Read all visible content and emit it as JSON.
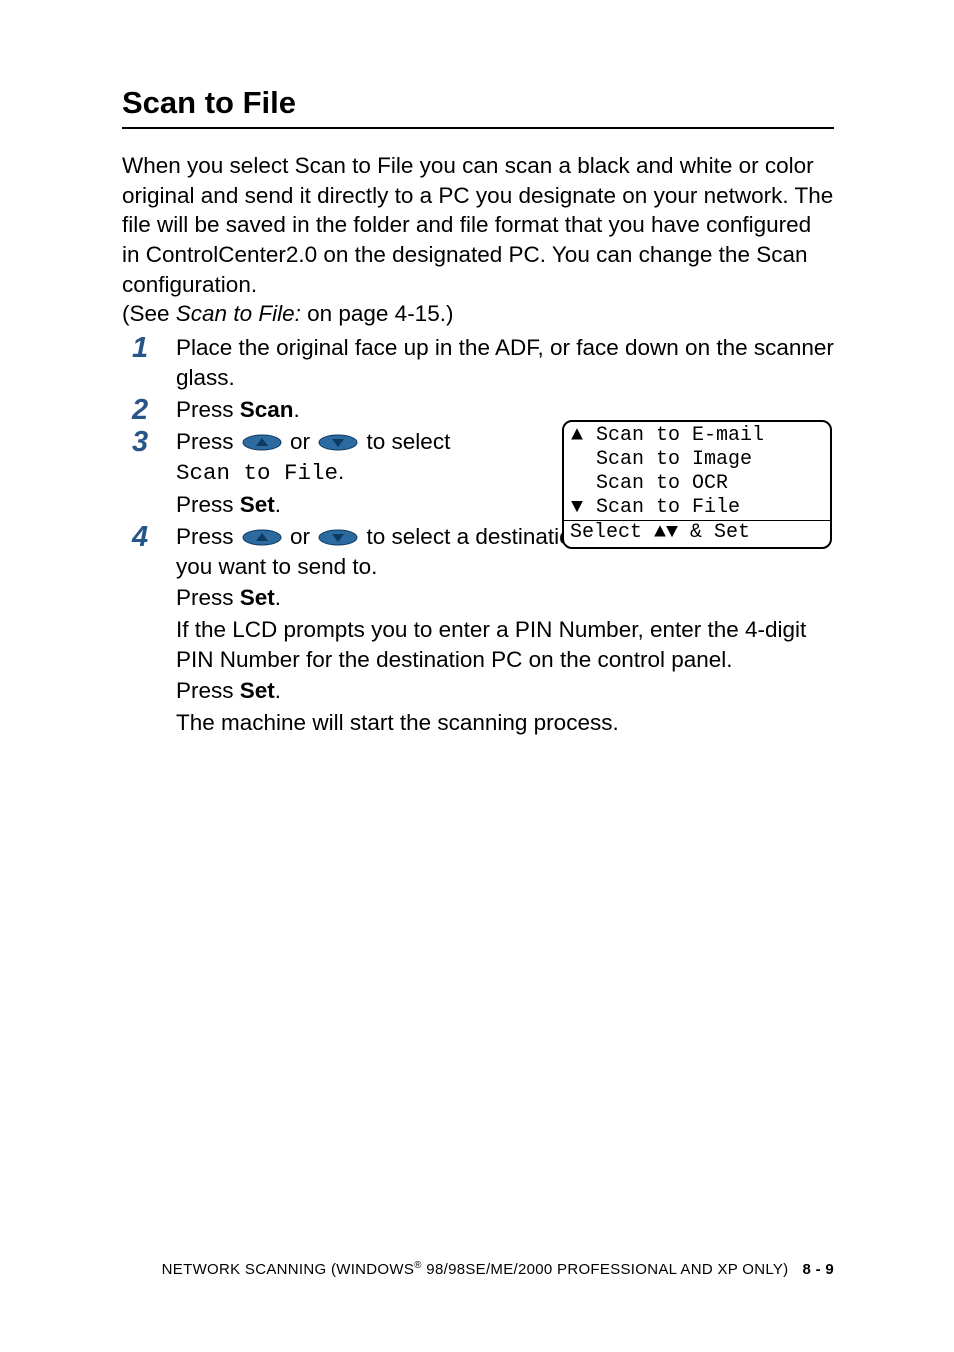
{
  "heading": "Scan to File",
  "intro": "When you select Scan to File you can scan a black and white or color original and send it directly to a PC you designate on your network. The file will be saved in the folder and file format that you have configured in ControlCenter2.0 on the designated PC. You can change the Scan configuration.",
  "xref": {
    "prefix": "(See ",
    "title": "Scan to File:",
    "suffix": " on page 4-15.)"
  },
  "step1": {
    "num": "1",
    "text": "Place the original face up in the ADF, or face down on the scanner glass."
  },
  "step2": {
    "num": "2",
    "press": "Press ",
    "scan": "Scan",
    "period": "."
  },
  "step3": {
    "num": "3",
    "press": "Press ",
    "or": " or ",
    "toSelect": " to select",
    "selection": "Scan to File",
    "periodAfterSelection": ".",
    "press2": "Press ",
    "set": "Set",
    "period2": "."
  },
  "step4": {
    "num": "4",
    "press": "Press ",
    "or": " or ",
    "toSelectA": " to select a destination you want to send to.",
    "press2": "Press ",
    "set": "Set",
    "period2": ".",
    "pinText": "If the LCD prompts you to enter a PIN Number, enter the 4-digit PIN Number for the destination PC on the control panel.",
    "press3": "Press ",
    "set3": "Set",
    "period3": ".",
    "startText": "The machine will start the scanning process."
  },
  "lcd": {
    "line1": {
      "arrow": "▲",
      "text": " Scan to E-mail"
    },
    "line2": {
      "arrow": " ",
      "text": " Scan to Image"
    },
    "line3": {
      "arrow": " ",
      "text": " Scan to OCR"
    },
    "line4": {
      "arrow": "▼",
      "text": " Scan to File"
    },
    "footer": "Select ▲▼ & Set"
  },
  "footer": {
    "prefix": "NETWORK SCANNING (WINDOWS",
    "reg": "®",
    "suffix": " 98/98SE/ME/2000 PROFESSIONAL AND XP ONLY)",
    "page": "8 - 9"
  }
}
